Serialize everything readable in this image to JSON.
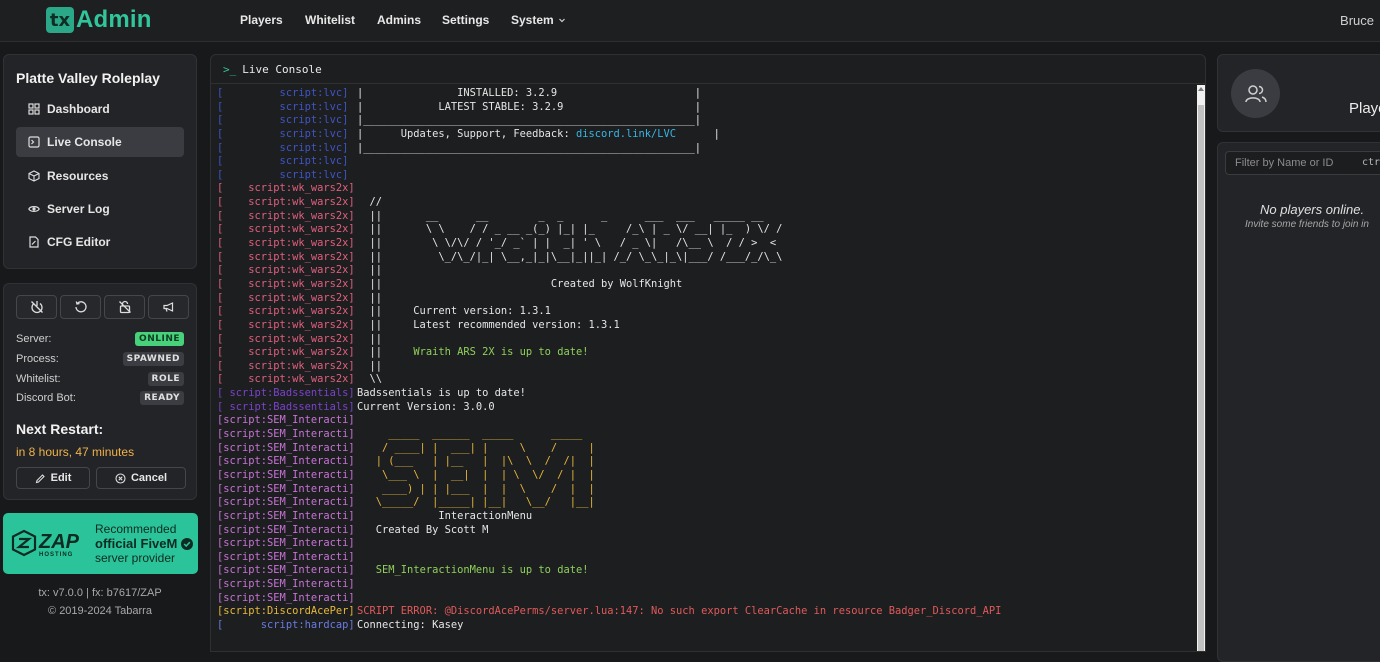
{
  "app": {
    "logo_mark": "tx",
    "logo_text": "Admin"
  },
  "nav": {
    "players": "Players",
    "whitelist": "Whitelist",
    "admins": "Admins",
    "settings": "Settings",
    "system": "System",
    "user": "Bruce"
  },
  "sidebar": {
    "server_name": "Platte Valley Roleplay",
    "items": [
      {
        "label": "Dashboard",
        "icon": "dashboard-icon"
      },
      {
        "label": "Live Console",
        "icon": "terminal-icon"
      },
      {
        "label": "Resources",
        "icon": "cube-icon"
      },
      {
        "label": "Server Log",
        "icon": "eye-icon"
      },
      {
        "label": "CFG Editor",
        "icon": "file-edit-icon"
      }
    ]
  },
  "status": {
    "server_label": "Server:",
    "server_value": "ONLINE",
    "process_label": "Process:",
    "process_value": "SPAWNED",
    "whitelist_label": "Whitelist:",
    "whitelist_value": "ROLE",
    "discord_label": "Discord Bot:",
    "discord_value": "READY",
    "accent_online": "#47d17a"
  },
  "restart": {
    "title": "Next Restart:",
    "value": "in 8 hours, 47 minutes",
    "edit": "Edit",
    "cancel": "Cancel",
    "color": "#f0b24a"
  },
  "promo": {
    "line1": "Recommended",
    "line2": "official FiveM",
    "line3": "server provider",
    "logo": "ZAP",
    "logo_sub": "HOSTING"
  },
  "footer": {
    "versions": "tx: v7.0.0 | fx: b7617/ZAP",
    "copyright": "© 2019-2024 Tabarra"
  },
  "console": {
    "title": "Live Console",
    "lines": [
      {
        "tag": "[         script:lvc]",
        "tc": "#3f55c4",
        "text": "|               INSTALLED: 3.2.9                      |",
        "mc": "#e6e6e6"
      },
      {
        "tag": "[         script:lvc]",
        "tc": "#3f55c4",
        "text": "|            LATEST STABLE: 3.2.9                     |",
        "mc": "#e6e6e6"
      },
      {
        "tag": "[         script:lvc]",
        "tc": "#3f55c4",
        "text": "|_____________________________________________________|",
        "mc": "#e6e6e6"
      },
      {
        "tag": "[         script:lvc]",
        "tc": "#3f55c4",
        "text": "|      Updates, Support, Feedback: ",
        "mc": "#e6e6e6",
        "link": "discord.link/LVC",
        "after": "      |"
      },
      {
        "tag": "[         script:lvc]",
        "tc": "#3f55c4",
        "text": "|_____________________________________________________|",
        "mc": "#e6e6e6"
      },
      {
        "tag": "[         script:lvc]",
        "tc": "#3f55c4",
        "text": "",
        "mc": "#e6e6e6"
      },
      {
        "tag": "[         script:lvc]",
        "tc": "#3f55c4",
        "text": "",
        "mc": "#e6e6e6"
      },
      {
        "tag": "[    script:wk_wars2x]",
        "tc": "#e0607e",
        "text": "",
        "mc": "#e6e6e6"
      },
      {
        "tag": "[    script:wk_wars2x]",
        "tc": "#e0607e",
        "text": "  //",
        "mc": "#e6e6e6"
      },
      {
        "tag": "[    script:wk_wars2x]",
        "tc": "#e0607e",
        "text": "  ||       __      __        _  _      _      ___  ___   _____ __",
        "mc": "#e6e6e6"
      },
      {
        "tag": "[    script:wk_wars2x]",
        "tc": "#e0607e",
        "text": "  ||       \\ \\    / / _ __ _(_) |_| |_     /_\\ | _ \\/ __| |_  ) \\/ /",
        "mc": "#e6e6e6"
      },
      {
        "tag": "[    script:wk_wars2x]",
        "tc": "#e0607e",
        "text": "  ||        \\ \\/\\/ / '_/ _` | |  _| ' \\   / _ \\|   /\\__ \\  / / >  <",
        "mc": "#e6e6e6"
      },
      {
        "tag": "[    script:wk_wars2x]",
        "tc": "#e0607e",
        "text": "  ||         \\_/\\_/|_| \\__,_|_|\\__|_||_| /_/ \\_\\_|_\\|___/ /___/_/\\_\\",
        "mc": "#e6e6e6"
      },
      {
        "tag": "[    script:wk_wars2x]",
        "tc": "#e0607e",
        "text": "  ||",
        "mc": "#e6e6e6"
      },
      {
        "tag": "[    script:wk_wars2x]",
        "tc": "#e0607e",
        "text": "  ||                           Created by WolfKnight",
        "mc": "#e6e6e6"
      },
      {
        "tag": "[    script:wk_wars2x]",
        "tc": "#e0607e",
        "text": "  ||",
        "mc": "#e6e6e6"
      },
      {
        "tag": "[    script:wk_wars2x]",
        "tc": "#e0607e",
        "text": "  ||     Current version: 1.3.1",
        "mc": "#e6e6e6"
      },
      {
        "tag": "[    script:wk_wars2x]",
        "tc": "#e0607e",
        "text": "  ||     Latest recommended version: 1.3.1",
        "mc": "#e6e6e6"
      },
      {
        "tag": "[    script:wk_wars2x]",
        "tc": "#e0607e",
        "text": "  ||",
        "mc": "#e6e6e6"
      },
      {
        "tag": "[    script:wk_wars2x]",
        "tc": "#e0607e",
        "text": "  ||     ",
        "mc": "#e6e6e6",
        "link2": "Wraith ARS 2X is up to date!"
      },
      {
        "tag": "[    script:wk_wars2x]",
        "tc": "#e0607e",
        "text": "  ||",
        "mc": "#e6e6e6"
      },
      {
        "tag": "[    script:wk_wars2x]",
        "tc": "#e0607e",
        "text": "  \\\\",
        "mc": "#e6e6e6"
      },
      {
        "tag": "[ script:Badssentials]",
        "tc": "#7a43c9",
        "text": "Badssentials is up to date!",
        "mc": "#e6e6e6"
      },
      {
        "tag": "[ script:Badssentials]",
        "tc": "#7a43c9",
        "text": "Current Version: 3.0.0",
        "mc": "#e6e6e6"
      },
      {
        "tag": "[script:SEM_Interacti]",
        "tc": "#c873d6",
        "text": "",
        "mc": "#e6e6e6"
      },
      {
        "tag": "[script:SEM_Interacti]",
        "tc": "#c873d6",
        "text": "     _____  ______  _____      _____",
        "mc": "#e8b83a"
      },
      {
        "tag": "[script:SEM_Interacti]",
        "tc": "#c873d6",
        "text": "    / ____| |  ___| |     \\    /     |",
        "mc": "#e8b83a"
      },
      {
        "tag": "[script:SEM_Interacti]",
        "tc": "#c873d6",
        "text": "   | (___   | |__   |  |\\  \\  /  /|  |",
        "mc": "#e8b83a"
      },
      {
        "tag": "[script:SEM_Interacti]",
        "tc": "#c873d6",
        "text": "    \\___ \\  |  __|  |  | \\  \\/  / |  |",
        "mc": "#e8b83a"
      },
      {
        "tag": "[script:SEM_Interacti]",
        "tc": "#c873d6",
        "text": "    ____) | | |___  |  |  \\    /  |  |",
        "mc": "#e8b83a"
      },
      {
        "tag": "[script:SEM_Interacti]",
        "tc": "#c873d6",
        "text": "   \\_____/  |_____| |__|   \\__/   |__|",
        "mc": "#e8b83a"
      },
      {
        "tag": "[script:SEM_Interacti]",
        "tc": "#c873d6",
        "text": "             InteractionMenu",
        "mc": "#e6e6e6"
      },
      {
        "tag": "[script:SEM_Interacti]",
        "tc": "#c873d6",
        "text": "   Created By Scott M",
        "mc": "#e6e6e6"
      },
      {
        "tag": "[script:SEM_Interacti]",
        "tc": "#c873d6",
        "text": "",
        "mc": "#e6e6e6"
      },
      {
        "tag": "[script:SEM_Interacti]",
        "tc": "#c873d6",
        "text": "",
        "mc": "#e6e6e6"
      },
      {
        "tag": "[script:SEM_Interacti]",
        "tc": "#c873d6",
        "text": "   ",
        "mc": "#e6e6e6",
        "link2": "SEM_InteractionMenu is up to date!"
      },
      {
        "tag": "[script:SEM_Interacti]",
        "tc": "#c873d6",
        "text": "",
        "mc": "#e6e6e6"
      },
      {
        "tag": "[script:SEM_Interacti]",
        "tc": "#c873d6",
        "text": "",
        "mc": "#e6e6e6"
      },
      {
        "tag": "[script:DiscordAcePer]",
        "tc": "#e8b83a",
        "text": "SCRIPT ERROR: @DiscordAcePerms/server.lua:147: No such export ClearCache in resource Badger_Discord_API",
        "mc": "#e05a5a"
      },
      {
        "tag": "[      script:hardcap]",
        "tc": "#6b7be0",
        "text": "Connecting: Kasey",
        "mc": "#e6e6e6"
      }
    ]
  },
  "players": {
    "title": "Players",
    "filter_placeholder": "Filter by Name or ID",
    "filter_kbd": "ctrl",
    "empty": "No players online.",
    "invite": "Invite some friends to join in"
  }
}
